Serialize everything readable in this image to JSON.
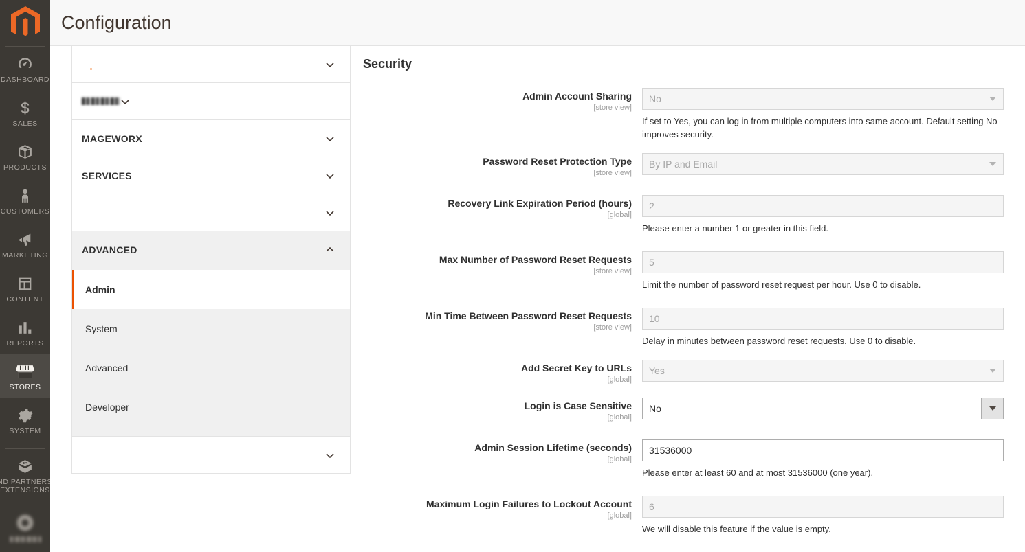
{
  "header": {
    "title": "Configuration",
    "logo_icon": "magento-logo-icon",
    "logo_color": "#ec6826"
  },
  "adminnav": {
    "items": [
      {
        "label": "DASHBOARD",
        "icon": "dashboard-gauge-icon",
        "active": false
      },
      {
        "label": "SALES",
        "icon": "dollar-sign-icon",
        "active": false
      },
      {
        "label": "PRODUCTS",
        "icon": "box-icon",
        "active": false
      },
      {
        "label": "CUSTOMERS",
        "icon": "person-icon",
        "active": false
      },
      {
        "label": "MARKETING",
        "icon": "megaphone-icon",
        "active": false
      },
      {
        "label": "CONTENT",
        "icon": "layout-page-icon",
        "active": false
      },
      {
        "label": "REPORTS",
        "icon": "bar-chart-icon",
        "active": false
      },
      {
        "label": "STORES",
        "icon": "storefront-icon",
        "active": true
      },
      {
        "label": "SYSTEM",
        "icon": "gear-icon",
        "active": false
      },
      {
        "label": "FIND PARTNERS\n& EXTENSIONS",
        "icon": "extension-block-icon",
        "active": false
      }
    ],
    "blurred_item": {
      "label": "",
      "icon": "blurred-icon"
    }
  },
  "tree": {
    "sections": [
      {
        "label": "",
        "blurred": false,
        "open": false,
        "has_dot": true,
        "chevron": "chevron-down-icon"
      },
      {
        "label": "",
        "blurred": true,
        "open": false,
        "has_dot": false,
        "chevron": "chevron-down-icon"
      },
      {
        "label": "MAGEWORX",
        "blurred": false,
        "open": false,
        "has_dot": false,
        "chevron": "chevron-down-icon"
      },
      {
        "label": "SERVICES",
        "blurred": false,
        "open": false,
        "has_dot": false,
        "chevron": "chevron-down-icon"
      },
      {
        "label": "",
        "blurred": false,
        "open": false,
        "has_dot": false,
        "chevron": "chevron-down-icon"
      },
      {
        "label": "ADVANCED",
        "blurred": false,
        "open": true,
        "has_dot": false,
        "chevron": "chevron-up-icon",
        "children": [
          {
            "label": "Admin",
            "current": true
          },
          {
            "label": "System",
            "current": false
          },
          {
            "label": "Advanced",
            "current": false
          },
          {
            "label": "Developer",
            "current": false
          }
        ]
      },
      {
        "label": "",
        "blurred": false,
        "open": false,
        "has_dot": false,
        "chevron": "chevron-down-icon"
      }
    ]
  },
  "form": {
    "section_title": "Security",
    "fields": [
      {
        "label": "Admin Account Sharing",
        "scope": "[store view]",
        "type": "select",
        "value": "No",
        "enabled": false,
        "note": "If set to Yes, you can log in from multiple computers into same account. Default setting No improves security."
      },
      {
        "label": "Password Reset Protection Type",
        "scope": "[store view]",
        "type": "select",
        "value": "By IP and Email",
        "enabled": false,
        "note": ""
      },
      {
        "label": "Recovery Link Expiration Period (hours)",
        "scope": "[global]",
        "type": "text",
        "value": "2",
        "enabled": false,
        "note": "Please enter a number 1 or greater in this field."
      },
      {
        "label": "Max Number of Password Reset Requests",
        "scope": "[store view]",
        "type": "text",
        "value": "5",
        "enabled": false,
        "note": "Limit the number of password reset request per hour. Use 0 to disable."
      },
      {
        "label": "Min Time Between Password Reset Requests",
        "scope": "[store view]",
        "type": "text",
        "value": "10",
        "enabled": false,
        "note": "Delay in minutes between password reset requests. Use 0 to disable."
      },
      {
        "label": "Add Secret Key to URLs",
        "scope": "[global]",
        "type": "select",
        "value": "Yes",
        "enabled": false,
        "note": ""
      },
      {
        "label": "Login is Case Sensitive",
        "scope": "[global]",
        "type": "select",
        "value": "No",
        "enabled": true,
        "note": ""
      },
      {
        "label": "Admin Session Lifetime (seconds)",
        "scope": "[global]",
        "type": "text",
        "value": "31536000",
        "enabled": true,
        "note": "Please enter at least 60 and at most 31536000 (one year)."
      },
      {
        "label": "Maximum Login Failures to Lockout Account",
        "scope": "[global]",
        "type": "text",
        "value": "6",
        "enabled": false,
        "note": "We will disable this feature if the value is empty."
      }
    ]
  }
}
